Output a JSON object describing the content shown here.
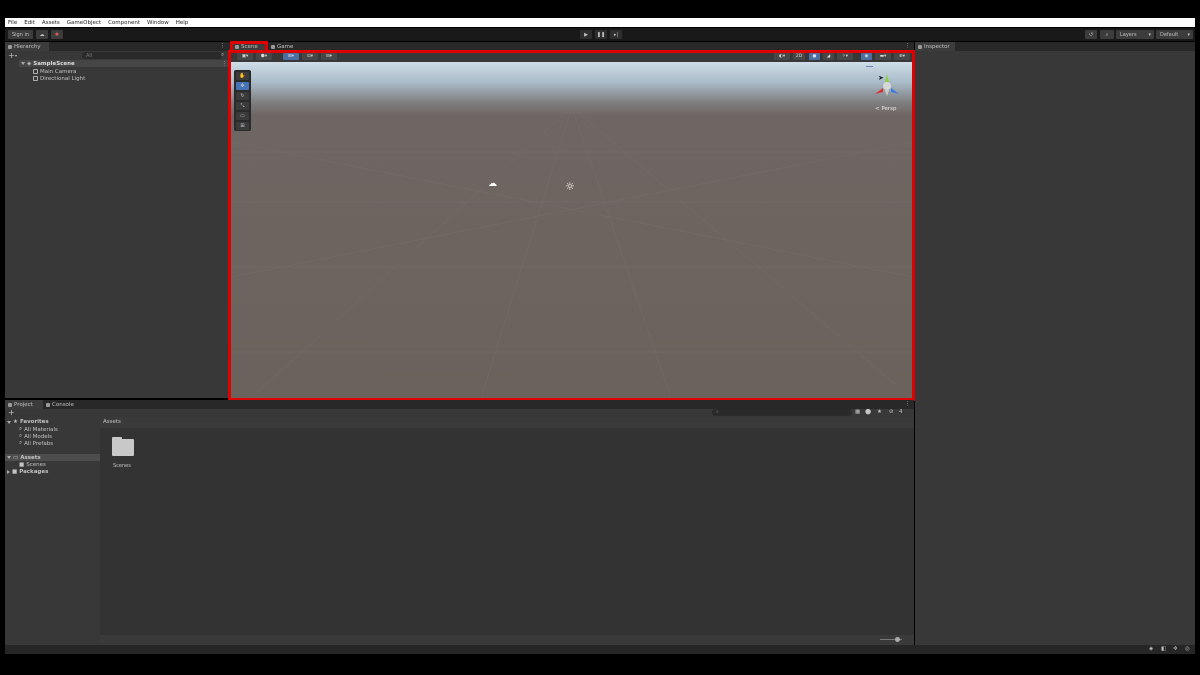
{
  "menu": [
    "File",
    "Edit",
    "Assets",
    "GameObject",
    "Component",
    "Window",
    "Help"
  ],
  "toolbar": {
    "sign_in": "Sign in",
    "layers": "Layers",
    "layout": "Default"
  },
  "hierarchy": {
    "tab": "Hierarchy",
    "search_placeholder": "All",
    "scene": "SampleScene",
    "items": [
      "Main Camera",
      "Directional Light"
    ]
  },
  "scene": {
    "tabs": [
      "Scene",
      "Game"
    ],
    "btn_2d": "2D",
    "persp_label": "< Persp",
    "colors": {
      "highlight": "#e00000",
      "sky": "#cfdee8",
      "ground": "#6c625c"
    }
  },
  "inspector": {
    "tab": "Inspector"
  },
  "project": {
    "tabs": [
      "Project",
      "Console"
    ],
    "breadcrumb": "Assets",
    "favorites": {
      "label": "Favorites",
      "items": [
        "All Materials",
        "All Models",
        "All Prefabs"
      ]
    },
    "assets": {
      "label": "Assets",
      "children": [
        "Scenes"
      ]
    },
    "packages": "Packages",
    "folder_label": "Scenes",
    "hidden_count": "4"
  }
}
